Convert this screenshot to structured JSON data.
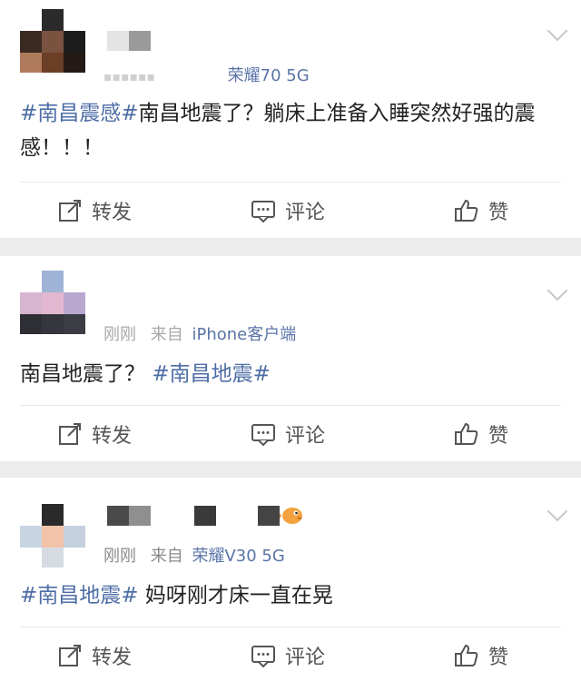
{
  "accent_color": "#4e6ea6",
  "actions": {
    "repost_label": "转发",
    "comment_label": "评论",
    "like_label": "赞"
  },
  "posts": [
    {
      "source_prefix": "",
      "device": "荣耀70 5G",
      "hashtag_1": "#南昌震感#",
      "text_1": "南昌地震了？躺床上准备入睡突然好强的震感！！！"
    },
    {
      "time": "刚刚",
      "from": "来自",
      "device": "iPhone客户端",
      "text_1": "南昌地震了？",
      "hashtag_1": "#南昌地震#"
    },
    {
      "time": "刚刚",
      "from": "来自",
      "device": "荣耀V30 5G",
      "hashtag_1": "#南昌地震#",
      "text_1": "妈呀刚才床一直在晃"
    }
  ]
}
